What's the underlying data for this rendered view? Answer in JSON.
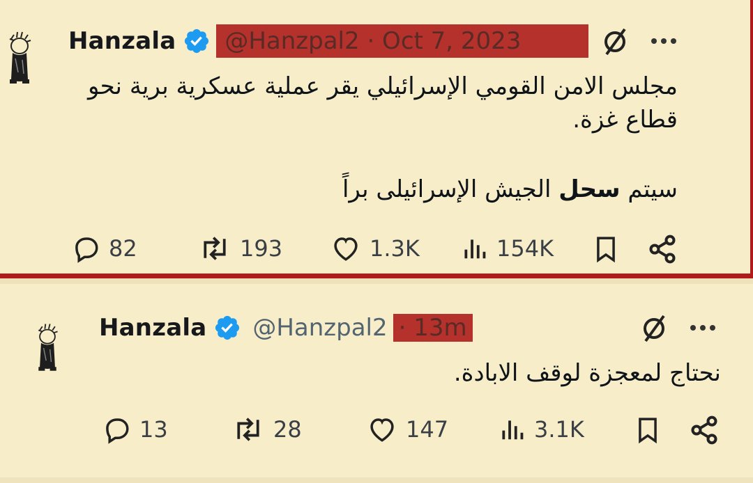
{
  "tweets": [
    {
      "author": "Hanzala",
      "handle_date": "@Hanzpal2 · Oct 7, 2023",
      "line1": "مجلس الامن القومي الإسرائيلي يقر عملية عسكرية برية نحو",
      "line2": "قطاع غزة.",
      "line3_pre": "سيتم ",
      "line3_bold": "سحل",
      "line3_post": " الجيش الإسرائيلى براً",
      "replies": "82",
      "reposts": "193",
      "likes": "1.3K",
      "views": "154K"
    },
    {
      "author": "Hanzala",
      "handle": "@Hanzpal2",
      "time": "· 13m",
      "line1": "نحتاج لمعجزة لوقف الابادة.",
      "replies": "13",
      "reposts": "28",
      "likes": "147",
      "views": "3.1K"
    }
  ],
  "colors": {
    "background": "#f7edc9",
    "highlight": "#b5312c",
    "verified": "#1d9bf0",
    "border": "#b11a1a"
  },
  "icons": [
    "avatar-hanzala",
    "verified-badge-icon",
    "grok-icon",
    "more-icon",
    "reply-icon",
    "repost-icon",
    "like-icon",
    "views-icon",
    "bookmark-icon",
    "share-icon"
  ]
}
